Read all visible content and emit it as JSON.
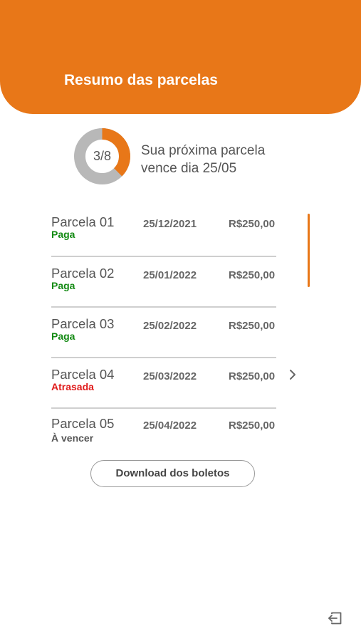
{
  "header": {
    "title": "Resumo das parcelas"
  },
  "summary": {
    "progress_label": "3/8",
    "paid": 3,
    "total": 8,
    "next_due_text": "Sua próxima parcela vence dia 25/05"
  },
  "colors": {
    "accent": "#e87718",
    "paid": "#138a13",
    "overdue": "#e01b1b",
    "donut_track": "#b8b8b8"
  },
  "installments": [
    {
      "name": "Parcela 01",
      "status": "Paga",
      "date": "25/12/2021",
      "value": "R$250,00"
    },
    {
      "name": "Parcela 02",
      "status": "Paga",
      "date": "25/01/2022",
      "value": "R$250,00"
    },
    {
      "name": "Parcela 03",
      "status": "Paga",
      "date": "25/02/2022",
      "value": "R$250,00"
    },
    {
      "name": "Parcela 04",
      "status": "Atrasada",
      "date": "25/03/2022",
      "value": "R$250,00"
    },
    {
      "name": "Parcela 05",
      "status": "À vencer",
      "date": "25/04/2022",
      "value": "R$250,00"
    }
  ],
  "download_button": {
    "label": "Download dos boletos"
  },
  "icons": {
    "chevron": "chevron-right-icon",
    "logout": "logout-icon"
  }
}
